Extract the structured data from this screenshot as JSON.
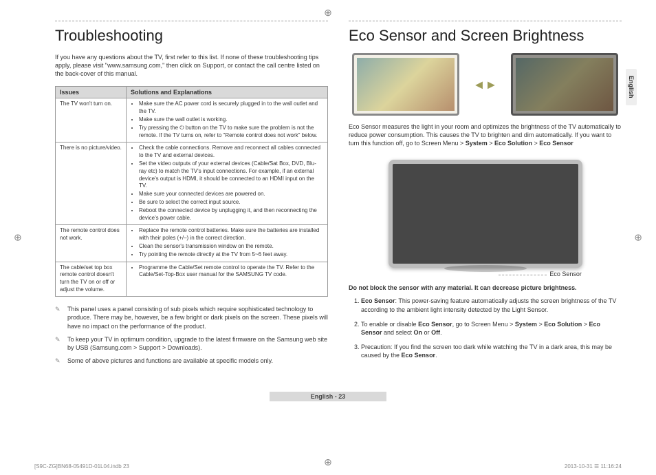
{
  "lang_tab": "English",
  "left": {
    "title": "Troubleshooting",
    "intro": "If you have any questions about the TV, first refer to this list. If none of these troubleshooting tips apply, please visit \"www.samsung.com,\" then click on Support, or contact the call centre listed on the back-cover of this manual.",
    "th1": "Issues",
    "th2": "Solutions and Explanations",
    "rows": [
      {
        "issue": "The TV won't turn on.",
        "sol": [
          "Make sure the AC power cord is securely plugged in to the wall outlet and the TV.",
          "Make sure the wall outlet is working.",
          "Try pressing the ⏻ button on the TV to make sure the problem is not the remote. If the TV turns on, refer to \"Remote control does not work\" below."
        ]
      },
      {
        "issue": "There is no picture/video.",
        "sol": [
          "Check the cable connections. Remove and reconnect all cables connected to the TV and external devices.",
          "Set the video outputs of your external devices (Cable/Sat Box, DVD, Blu-ray etc) to match the TV's input connections. For example, if an external device's output is HDMI, it should be connected to an HDMI input on the TV.",
          "Make sure your connected devices are powered on.",
          "Be sure to select the correct input source.",
          "Reboot the connected device by unplugging it, and then reconnecting the device's power cable."
        ]
      },
      {
        "issue": "The remote control does not work.",
        "sol": [
          "Replace the remote control batteries. Make sure the batteries are installed with their poles (+/–) in the correct direction.",
          "Clean the sensor's transmission window on the remote.",
          "Try pointing the remote directly at the TV from 5~6 feet away."
        ]
      },
      {
        "issue": "The cable/set top box remote control doesn't turn the TV on or off or adjust the volume.",
        "sol": [
          "Programme the Cable/Set remote control to operate the TV. Refer to the Cable/Set-Top-Box user manual for the SAMSUNG TV code."
        ]
      }
    ],
    "notes": [
      "This panel uses a panel consisting of sub pixels which require sophisticated technology to produce. There may be, however, be a few bright or dark pixels on the screen. These pixels will have no impact on the performance of the product.",
      "To keep your TV in optimum condition, upgrade to the latest firmware on the Samsung web site by USB (Samsung.com > Support > Downloads).",
      "Some of above pictures and functions are available at specific models only."
    ]
  },
  "right": {
    "title": "Eco Sensor and Screen Brightness",
    "para_pre": "Eco Sensor measures the light in your room and optimizes the brightness of the TV automatically to reduce power consumption. This causes the TV to brighten and dim automatically. If you want to turn this function off, go to Screen Menu > ",
    "para_b1": "System",
    "para_mid": " > ",
    "para_b2": "Eco Solution",
    "para_mid2": " > ",
    "para_b3": "Eco Sensor",
    "eco_label": "Eco Sensor",
    "warn": "Do not block the sensor with any material. It can decrease picture brightness.",
    "list": [
      {
        "b": "Eco Sensor",
        "t": ": This power-saving feature automatically adjusts the screen brightness of the TV according to the ambient light intensity detected by the Light Sensor."
      },
      {
        "pre": "To enable or disable ",
        "b": "Eco Sensor",
        "t": ", go to Screen Menu > ",
        "b2": "System",
        "t2": " > ",
        "b3": "Eco Solution",
        "t3": " > ",
        "b4": "Eco Sensor",
        "t4": " and select ",
        "b5": "On",
        "t5": " or ",
        "b6": "Off",
        "t6": "."
      },
      {
        "pre": "Precaution: If you find the screen too dark while watching the TV in a dark area, this may be caused by the ",
        "b": "Eco Sensor",
        "t": "."
      }
    ]
  },
  "footer": "English - 23",
  "print_left": "[S9C-ZG]BN68-05491D-01L04.indb   23",
  "print_right": "2013-10-31   ☰ 11:16:24"
}
